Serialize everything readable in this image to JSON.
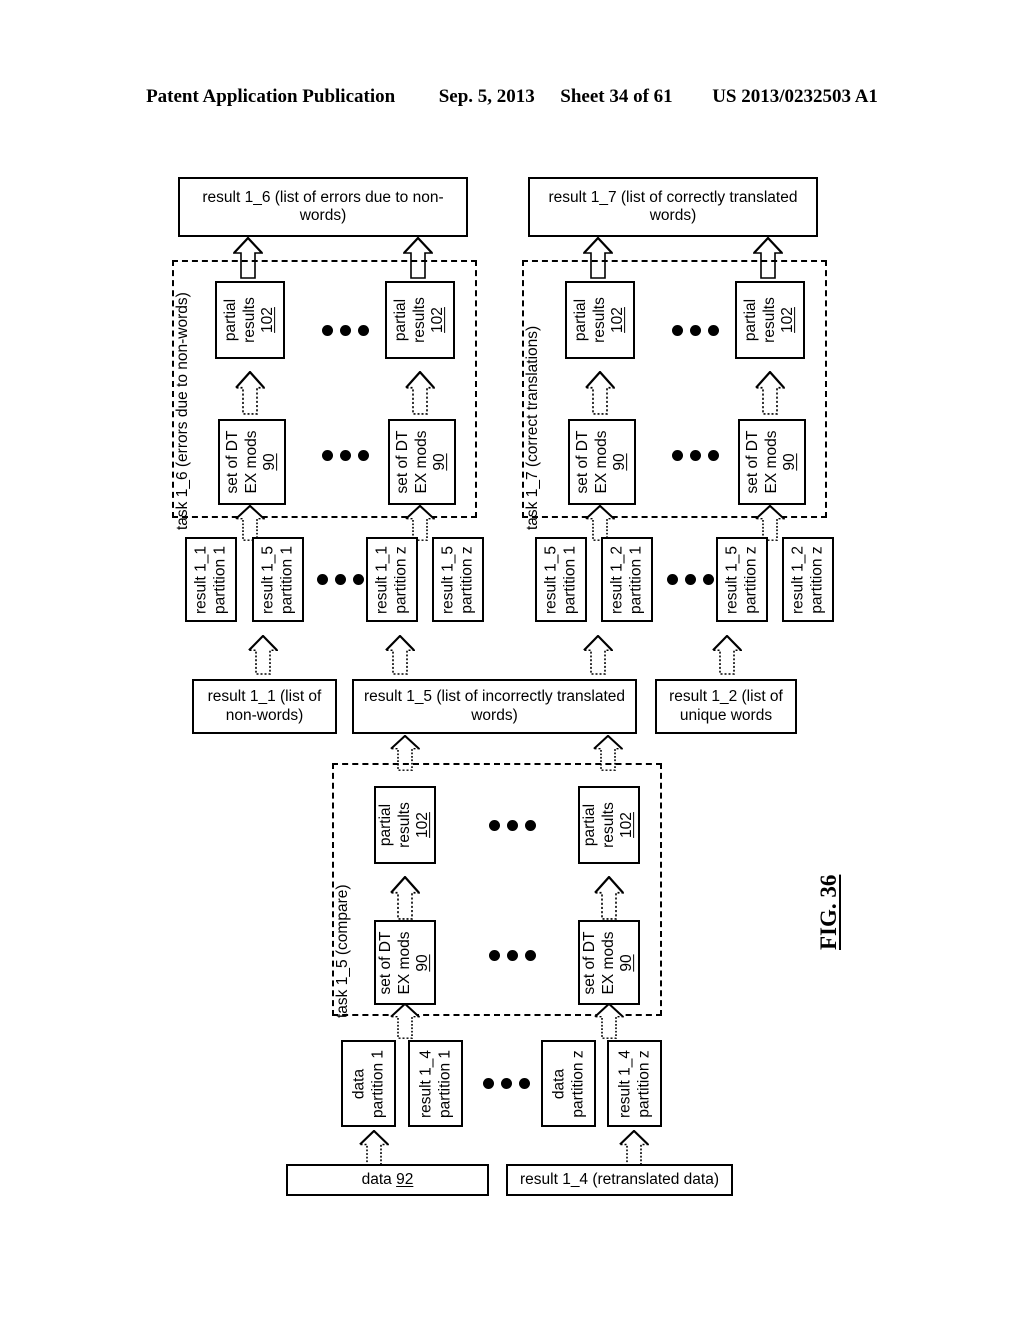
{
  "header": {
    "publication": "Patent Application Publication",
    "date": "Sep. 5, 2013",
    "sheet": "Sheet 34 of 61",
    "patent_number": "US 2013/0232503 A1"
  },
  "figure": {
    "label": "FIG. 36"
  },
  "top_results": [
    {
      "id": "result-1-6",
      "text": "result 1_6 (list of errors due to non-words)"
    },
    {
      "id": "result-1-7",
      "text": "result 1_7 (list of correctly translated words)"
    }
  ],
  "tasks": [
    {
      "id": "task-1-6",
      "label": "task 1_6 (errors due to non-words)",
      "partial_results": [
        {
          "line1": "partial",
          "line2": "results",
          "ref": "102"
        },
        {
          "line1": "partial",
          "line2": "results",
          "ref": "102"
        }
      ],
      "dt_ex_mods": [
        {
          "line1": "set of DT",
          "line2": "EX mods",
          "ref": "90"
        },
        {
          "line1": "set of DT",
          "line2": "EX mods",
          "ref": "90"
        }
      ]
    },
    {
      "id": "task-1-7",
      "label": "task 1_7 (correct translations)",
      "partial_results": [
        {
          "line1": "partial",
          "line2": "results",
          "ref": "102"
        },
        {
          "line1": "partial",
          "line2": "results",
          "ref": "102"
        }
      ],
      "dt_ex_mods": [
        {
          "line1": "set of DT",
          "line2": "EX mods",
          "ref": "90"
        },
        {
          "line1": "set of DT",
          "line2": "EX mods",
          "ref": "90"
        }
      ]
    },
    {
      "id": "task-1-5",
      "label": "task 1_5 (compare)",
      "partial_results": [
        {
          "line1": "partial",
          "line2": "results",
          "ref": "102"
        },
        {
          "line1": "partial",
          "line2": "results",
          "ref": "102"
        }
      ],
      "dt_ex_mods": [
        {
          "line1": "set of DT",
          "line2": "EX mods",
          "ref": "90"
        },
        {
          "line1": "set of DT",
          "line2": "EX mods",
          "ref": "90"
        }
      ]
    }
  ],
  "partition_row_left": [
    {
      "line1": "result 1_1",
      "line2": "partition 1"
    },
    {
      "line1": "result 1_5",
      "line2": "partition 1"
    },
    {
      "line1": "result 1_1",
      "line2": "partition z"
    },
    {
      "line1": "result 1_5",
      "line2": "partition z"
    }
  ],
  "partition_row_right": [
    {
      "line1": "result 1_5",
      "line2": "partition 1"
    },
    {
      "line1": "result 1_2",
      "line2": "partition 1"
    },
    {
      "line1": "result 1_5",
      "line2": "partition z"
    },
    {
      "line1": "result 1_2",
      "line2": "partition z"
    }
  ],
  "mid_results": [
    {
      "id": "result-1-1",
      "text": "result 1_1 (list of non-words)"
    },
    {
      "id": "result-1-5",
      "text": "result 1_5 (list of incorrectly translated words)"
    },
    {
      "id": "result-1-2",
      "text": "result 1_2 (list of unique words"
    }
  ],
  "bottom_partitions": [
    {
      "line1": "data",
      "line2": "partition 1"
    },
    {
      "line1": "result 1_4",
      "line2": "partition 1"
    },
    {
      "line1": "data",
      "line2": "partition z"
    },
    {
      "line1": "result 1_4",
      "line2": "partition z"
    }
  ],
  "bottom_sources": [
    {
      "id": "data-92",
      "prefix": "data ",
      "ref": "92",
      "suffix": ""
    },
    {
      "id": "result-1-4",
      "prefix": "result 1_4 (retranslated data)",
      "ref": "",
      "suffix": ""
    }
  ]
}
